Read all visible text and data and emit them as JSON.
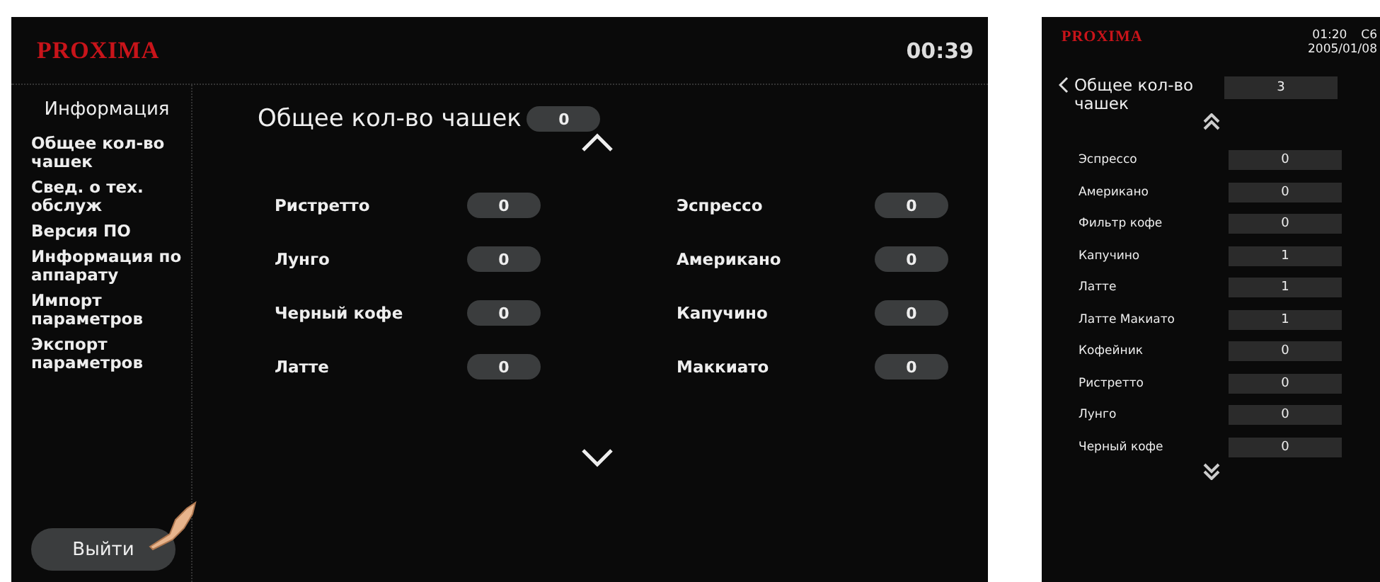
{
  "main_screen": {
    "logo": "PROXIMA",
    "time": "00:39",
    "sidebar": {
      "title": "Информация",
      "items": [
        {
          "label": "Общее кол-во чашек"
        },
        {
          "label": "Свед. о тех. обслуж"
        },
        {
          "label": "Версия ПО"
        },
        {
          "label": "Информация по аппарату"
        },
        {
          "label": "Импорт параметров"
        },
        {
          "label": "Экспорт параметров"
        }
      ]
    },
    "exit_button": "Выйти",
    "total": {
      "label": "Общее кол-во чашек",
      "value": "0"
    },
    "drinks": [
      {
        "name": "Ристретто",
        "count": "0"
      },
      {
        "name": "Лунго",
        "count": "0"
      },
      {
        "name": "Черный кофе",
        "count": "0"
      },
      {
        "name": "Латте",
        "count": "0"
      },
      {
        "name": "Эспрессо",
        "count": "0"
      },
      {
        "name": "Американо",
        "count": "0"
      },
      {
        "name": "Капучино",
        "count": "0"
      },
      {
        "name": "Маккиато",
        "count": "0"
      }
    ]
  },
  "mobile_screen": {
    "logo": "PROXIMA",
    "time": "01:20",
    "code": "C6",
    "date": "2005/01/08",
    "total": {
      "label": "Общее кол-во чашек",
      "value": "3"
    },
    "drinks": [
      {
        "name": "Эспрессо",
        "count": "0"
      },
      {
        "name": "Американо",
        "count": "0"
      },
      {
        "name": "Фильтр кофе",
        "count": "0"
      },
      {
        "name": "Капучино",
        "count": "1"
      },
      {
        "name": "Латте",
        "count": "1"
      },
      {
        "name": "Латте Макиато",
        "count": "1"
      },
      {
        "name": "Кофейник",
        "count": "0"
      },
      {
        "name": "Ристретто",
        "count": "0"
      },
      {
        "name": "Лунго",
        "count": "0"
      },
      {
        "name": "Черный кофе",
        "count": "0"
      }
    ]
  }
}
